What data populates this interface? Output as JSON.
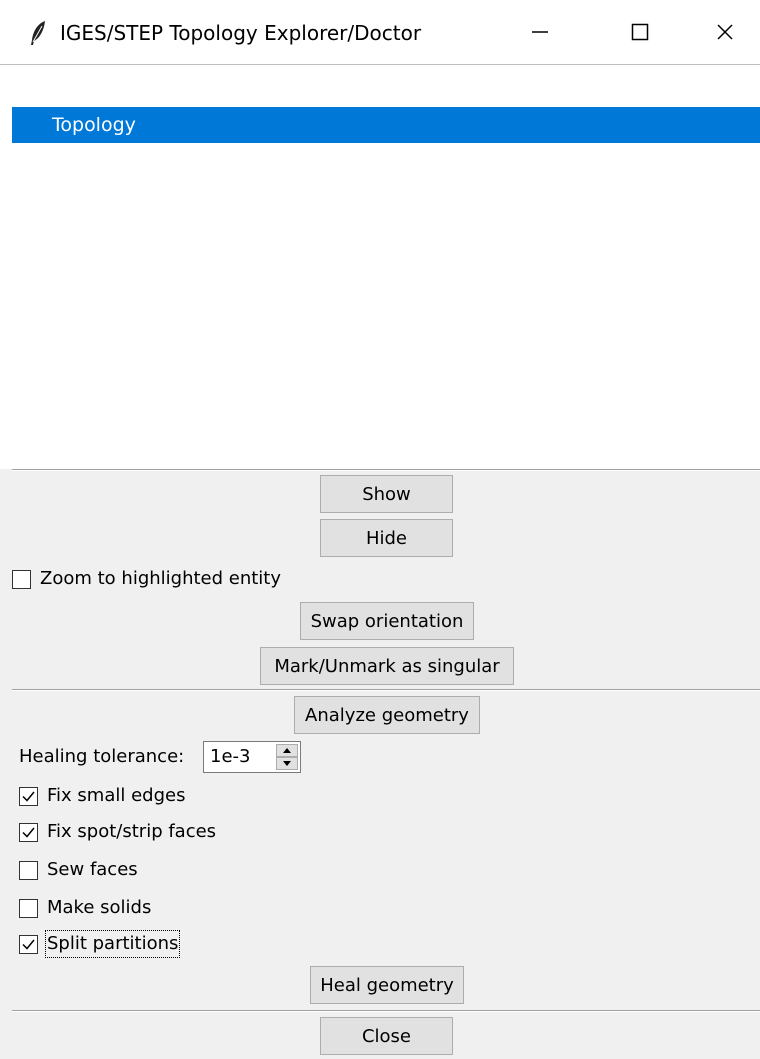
{
  "window": {
    "title": "IGES/STEP Topology Explorer/Doctor",
    "icon": "feather-icon",
    "controls": [
      "minimize-icon",
      "maximize-icon",
      "close-icon"
    ]
  },
  "tree": {
    "selected_item": "Topology"
  },
  "display": {
    "show_label": "Show",
    "hide_label": "Hide",
    "zoom_label": "Zoom to highlighted entity",
    "zoom_checked": false,
    "swap_label": "Swap orientation",
    "mark_label": "Mark/Unmark as singular"
  },
  "healing": {
    "analyze_label": "Analyze geometry",
    "tolerance_label": "Healing tolerance:",
    "tolerance_value": "1e-3",
    "options": [
      {
        "label": "Fix small edges",
        "checked": true
      },
      {
        "label": "Fix spot/strip faces",
        "checked": true
      },
      {
        "label": "Sew faces",
        "checked": false
      },
      {
        "label": "Make solids",
        "checked": false
      },
      {
        "label": "Split partitions",
        "checked": true
      }
    ],
    "heal_label": "Heal geometry"
  },
  "footer": {
    "close_label": "Close"
  }
}
